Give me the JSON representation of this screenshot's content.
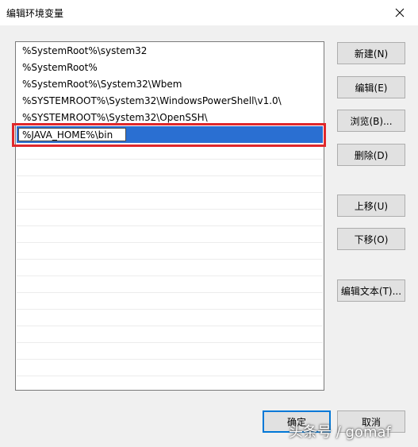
{
  "window": {
    "title": "编辑环境变量"
  },
  "list": {
    "items": [
      "%SystemRoot%\\system32",
      "%SystemRoot%",
      "%SystemRoot%\\System32\\Wbem",
      "%SYSTEMROOT%\\System32\\WindowsPowerShell\\v1.0\\",
      "%SYSTEMROOT%\\System32\\OpenSSH\\"
    ],
    "editing_value": "%JAVA_HOME%\\bin"
  },
  "buttons": {
    "new": "新建(N)",
    "edit": "编辑(E)",
    "browse": "浏览(B)...",
    "delete": "删除(D)",
    "move_up": "上移(U)",
    "move_down": "下移(O)",
    "edit_text": "编辑文本(T)...",
    "ok": "确定",
    "cancel": "取消"
  },
  "watermark": "头条号 / gomaf",
  "colors": {
    "selection": "#2a6fd2",
    "highlight_box": "#e0282b"
  }
}
